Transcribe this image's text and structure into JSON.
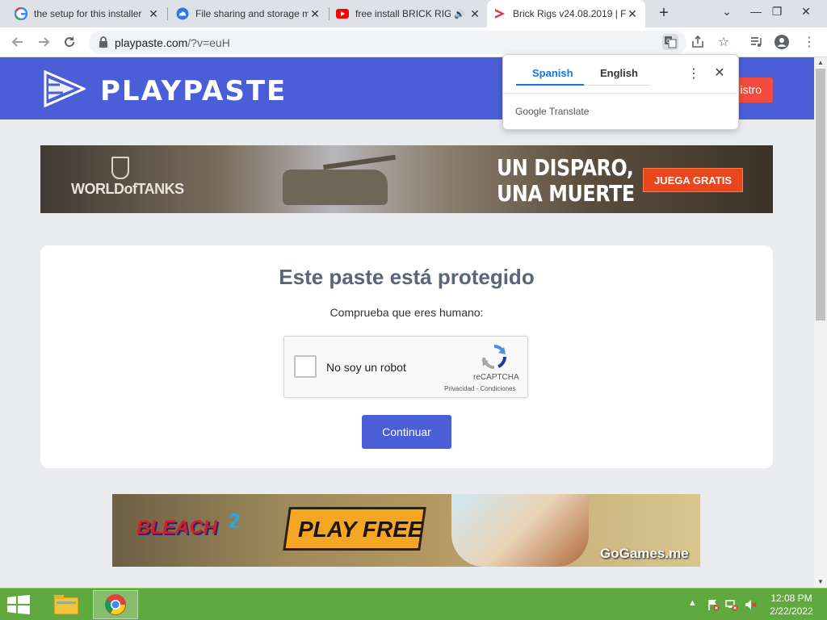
{
  "browser": {
    "tabs": [
      {
        "title": "the setup for this installer",
        "favicon": "google-g-icon"
      },
      {
        "title": "File sharing and storage ma",
        "favicon": "cloud-icon"
      },
      {
        "title": "free install BRICK RIGS",
        "favicon": "youtube-icon",
        "audio": true
      },
      {
        "title": "Brick Rigs v24.08.2019 | F",
        "favicon": "playpaste-icon",
        "active": true
      }
    ],
    "url": {
      "host": "playpaste.com",
      "path": "/?v=euH"
    }
  },
  "site": {
    "logo_text": "PLAYPASTE",
    "register_label": "istro"
  },
  "ad_top": {
    "brand": "WORLDofTANKS",
    "slogan_line1": "UN DISPARO,",
    "slogan_line2": "UNA MUERTE",
    "cta": "JUEGA GRATIS"
  },
  "card": {
    "title": "Este paste está protegido",
    "subtitle": "Comprueba que eres humano:",
    "captcha_label": "No soy un robot",
    "captcha_brand": "reCAPTCHA",
    "captcha_terms": "Privacidad - Condiciones",
    "continue_label": "Continuar"
  },
  "ad_bottom": {
    "brand": "BLEACH",
    "brand_number": "2",
    "cta": "PLAY FREE",
    "site": "GoGames.me"
  },
  "translate_popup": {
    "source_lang": "Spanish",
    "target_lang": "English",
    "footer": "Google Translate"
  },
  "taskbar": {
    "time": "12:08 PM",
    "date": "2/22/2022"
  },
  "colors": {
    "header_blue": "#4a5ed8",
    "register_red": "#f24b3d",
    "taskbar_green": "#5fa93e"
  }
}
